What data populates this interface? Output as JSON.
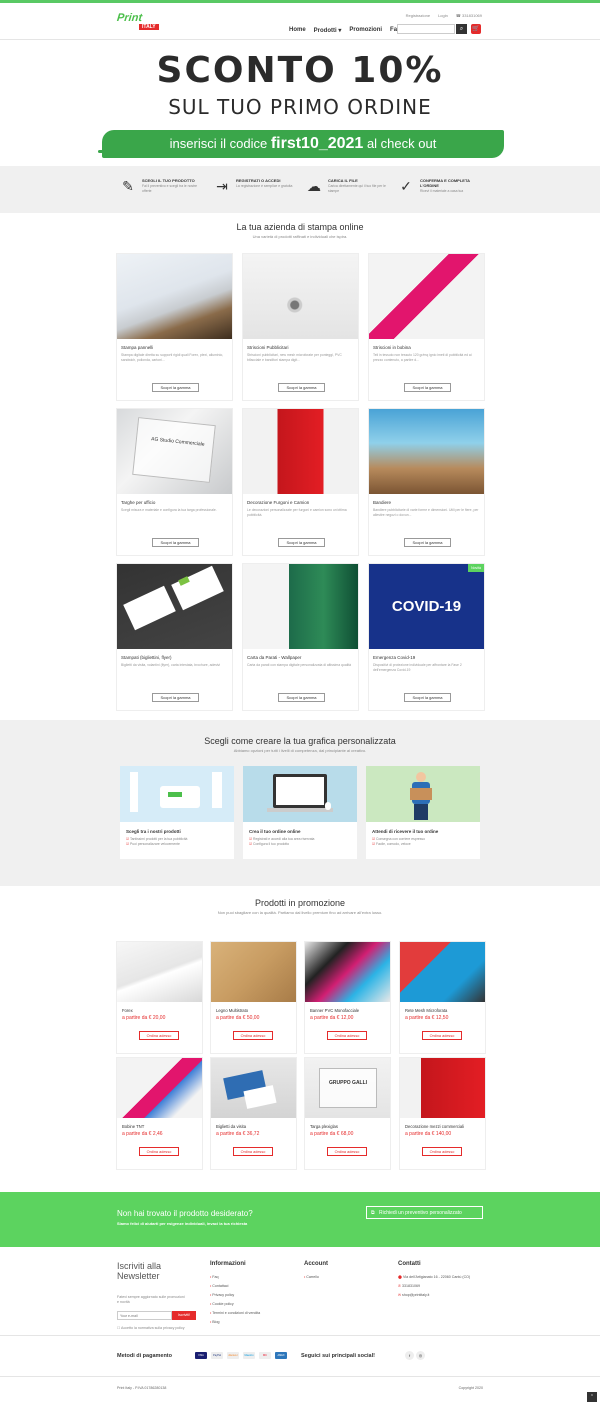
{
  "header": {
    "logo_text": "Print",
    "logo_tag": "ITALY",
    "links": [
      "Registrazione",
      "Login",
      "☎ 331831069"
    ],
    "nav": [
      "Home",
      "Prodotti ▾",
      "Promozioni",
      "Faq"
    ],
    "search_placeholder": ""
  },
  "hero": {
    "title": "SCONTO 10%",
    "subtitle": "SUL TUO PRIMO ORDINE",
    "strip_pre": "inserisci il codice ",
    "strip_code": "first10_2021",
    "strip_post": " al check out"
  },
  "steps": [
    {
      "icon": "✎",
      "icon_name": "edit-icon",
      "title": "SCEGLI IL TUO PRODOTTO",
      "desc": "Fai il preventivo e scegli tra le nostre offerte"
    },
    {
      "icon": "⇥",
      "icon_name": "login-icon",
      "title": "REGISTRATI O ACCEDI",
      "desc": "La registrazione è semplice e gratuita"
    },
    {
      "icon": "☁",
      "icon_name": "cloud-upload-icon",
      "title": "CARICA IL FILE",
      "desc": "Carica direttamente qui il tuo file per le stampe"
    },
    {
      "icon": "✓",
      "icon_name": "check-circle-icon",
      "title": "CONFERMA E COMPLETA L'ORDINE",
      "desc": "Ricevi il materiale a casa tua"
    }
  ],
  "products_section": {
    "title": "La tua azienda di stampa online",
    "subtitle": "Una varietà di prodotti raffinati e individuali che ispira."
  },
  "products": [
    {
      "name": "Stampa pannelli",
      "desc": "Stampa digitale diretta su supporti rigidi quali Forex, plexi, alluminio, sandwich, polionda, cartoni...",
      "btn": "Scopri la gamma"
    },
    {
      "name": "Striscioni Pubblicitari",
      "desc": "Striscioni pubblicitari, new mesh microforate per ponteggi, PVC bifacciale e banditori stampa digit...",
      "btn": "Scopri la gamma"
    },
    {
      "name": "Striscioni in bobina",
      "desc": "Teli in tessuto non tessuto 120 gr/mq ignio imeti di pubblicità ed ai prezzo contenuto, a partire d...",
      "btn": "Scopri la gamma"
    },
    {
      "name": "Targhe per ufficio",
      "desc": "Scegli misura e materiale e configura la tua targa professionale.",
      "btn": "Scopri la gamma"
    },
    {
      "name": "Decorazione Furgoni e Camion",
      "desc": "Le decorazioni personalizzate per furgoni e camion sono un'ottima pubblicità.",
      "btn": "Scopri la gamma"
    },
    {
      "name": "Bandiere",
      "desc": "Bandiere pubblicitarie di varie forme e dimensioni. Utili per le fiere, per allestire negozi o dovun...",
      "btn": "Scopri la gamma"
    },
    {
      "name": "Stampati (bigliettini, flyer)",
      "desc": "Biglietti da visita, volantini (flyer), carta intestata, brochure, adesivi",
      "btn": "Scopri la gamma"
    },
    {
      "name": "Carta da Parati - Wallpaper",
      "desc": "Carta da parati con stampa digitale personalizzata di altissima qualità",
      "btn": "Scopri la gamma"
    },
    {
      "name": "Emergenza Covid-19",
      "desc": "Dispositivi di protezione individuale per affrontare la Fase 2 dell'emergenza Covid-19",
      "btn": "Scopri la gamma",
      "badge": "Novità",
      "img_text": "COVID-19"
    }
  ],
  "graphics_section": {
    "title": "Scegli come creare la tua grafica personalizzata",
    "subtitle": "Abbiamo opzioni per tutti i livelli di competenza, dal principiante al creativo.",
    "cards": [
      {
        "title": "Scegli tra i nostri prodotti",
        "items": [
          "Tantissimi prodotti per la tua pubblicità",
          "Puoi personalizzare velocemente"
        ]
      },
      {
        "title": "Crea il tuo ordine online",
        "items": [
          "Registrati e accedi alla tua area riservata",
          "Configura il tuo prodotto"
        ]
      },
      {
        "title": "Attendi di ricevere il tuo ordine",
        "items": [
          "Consegna con corriere espresso",
          "Facile, comodo, veloce"
        ]
      }
    ]
  },
  "promo_section": {
    "title": "Prodotti in promozione",
    "subtitle": "Non puoi sbagliare con la qualità. Partiamo dal livello premium fino ad arrivare all'extra lusso."
  },
  "promos": [
    {
      "name": "Forex",
      "price": "a partire da € 20,00",
      "btn": "Ordina adesso"
    },
    {
      "name": "Legno Multistrato",
      "price": "a partire da € 50,00",
      "btn": "Ordina adesso"
    },
    {
      "name": "Banner PVC Monofacciale",
      "price": "a partire da € 12,00",
      "btn": "Ordina adesso"
    },
    {
      "name": "Rete Mesh Microforata",
      "price": "a partire da € 12,50",
      "btn": "Ordina adesso"
    },
    {
      "name": "Bobine TNT",
      "price": "a partire da € 2,46",
      "btn": "Ordina adesso"
    },
    {
      "name": "Biglietti da visita",
      "price": "a partire da € 36,72",
      "btn": "Ordina adesso"
    },
    {
      "name": "Targa plexiglas",
      "price": "a partire da € 68,00",
      "btn": "Ordina adesso"
    },
    {
      "name": "Decorazione mezzi commerciali",
      "price": "a partire da € 140,00",
      "btn": "Ordina adesso"
    }
  ],
  "cta": {
    "title": "Non hai trovato il prodotto desiderato?",
    "subtitle": "Siamo felici di aiutarti per esigenze individuali, invaci la tua richiesta",
    "button": "Richiedi un preventivo personalizzato"
  },
  "footer": {
    "newsletter_title": "Iscriviti alla Newsletter",
    "newsletter_text": "Fatevi sempre aggiornato sulle promozioni e novità",
    "newsletter_placeholder": "Your e-mail",
    "newsletter_button": "Iscriviti!",
    "newsletter_consent": "Accetto la normativa sulla privacy policy",
    "info_title": "Informazioni",
    "info_links": [
      "Faq",
      "Contattaci",
      "Privacy policy",
      "Cookie policy",
      "Termini e condizioni di vendita",
      "Blog"
    ],
    "account_title": "Account",
    "account_links": [
      "Carrello"
    ],
    "contact_title": "Contatti",
    "contact_items": [
      "Via dell'Artigianato 16 - 22060 Cantù (CO)",
      "331831069",
      "shop@printitaly.it"
    ],
    "payments_title": "Metodi di pagamento",
    "payment_logos": [
      "VISA",
      "PayPal",
      "discover",
      "Maestro",
      "MC",
      "AMEX"
    ],
    "social_title": "Seguici sui principali social!",
    "copy_left": "Print Italy - P.IVA 01786280138",
    "copy_right": "Copyright 2020"
  }
}
